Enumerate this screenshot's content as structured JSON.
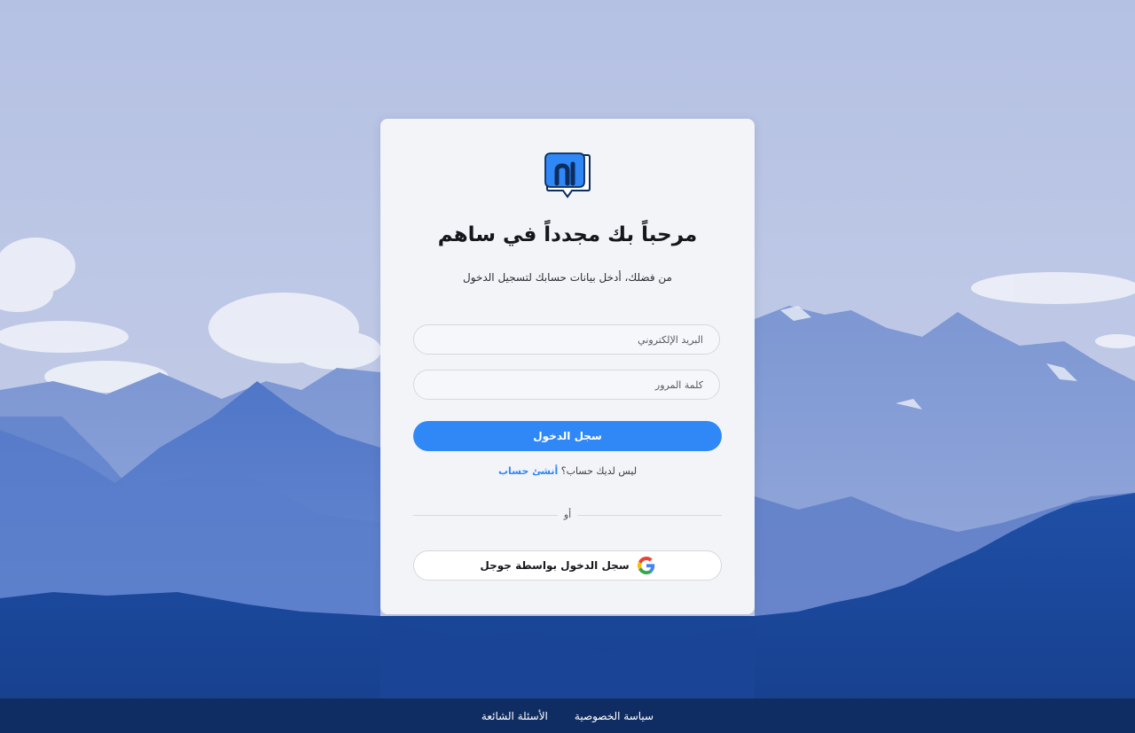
{
  "title": "مرحباً بك مجدداً في ساهم",
  "subtitle": "من فضلك، أدخل بيانات حسابك لتسجيل الدخول",
  "email": {
    "placeholder": "البريد الإلكتروني",
    "value": ""
  },
  "password": {
    "placeholder": "كلمة المرور",
    "value": ""
  },
  "login_button": "سجل الدخول",
  "signup": {
    "prompt": "ليس لديك حساب؟",
    "link": "أنشئ حساب"
  },
  "divider_label": "أو",
  "google_button": "سجل الدخول بواسطة جوجل",
  "footer": {
    "privacy": "سياسة الخصوصية",
    "faq": "الأسئلة الشائعة"
  },
  "colors": {
    "primary": "#2f88f6",
    "footer": "#0f2d63",
    "logo_dark": "#0d2d5e"
  },
  "icons": [
    "logo-icon",
    "google-icon"
  ]
}
